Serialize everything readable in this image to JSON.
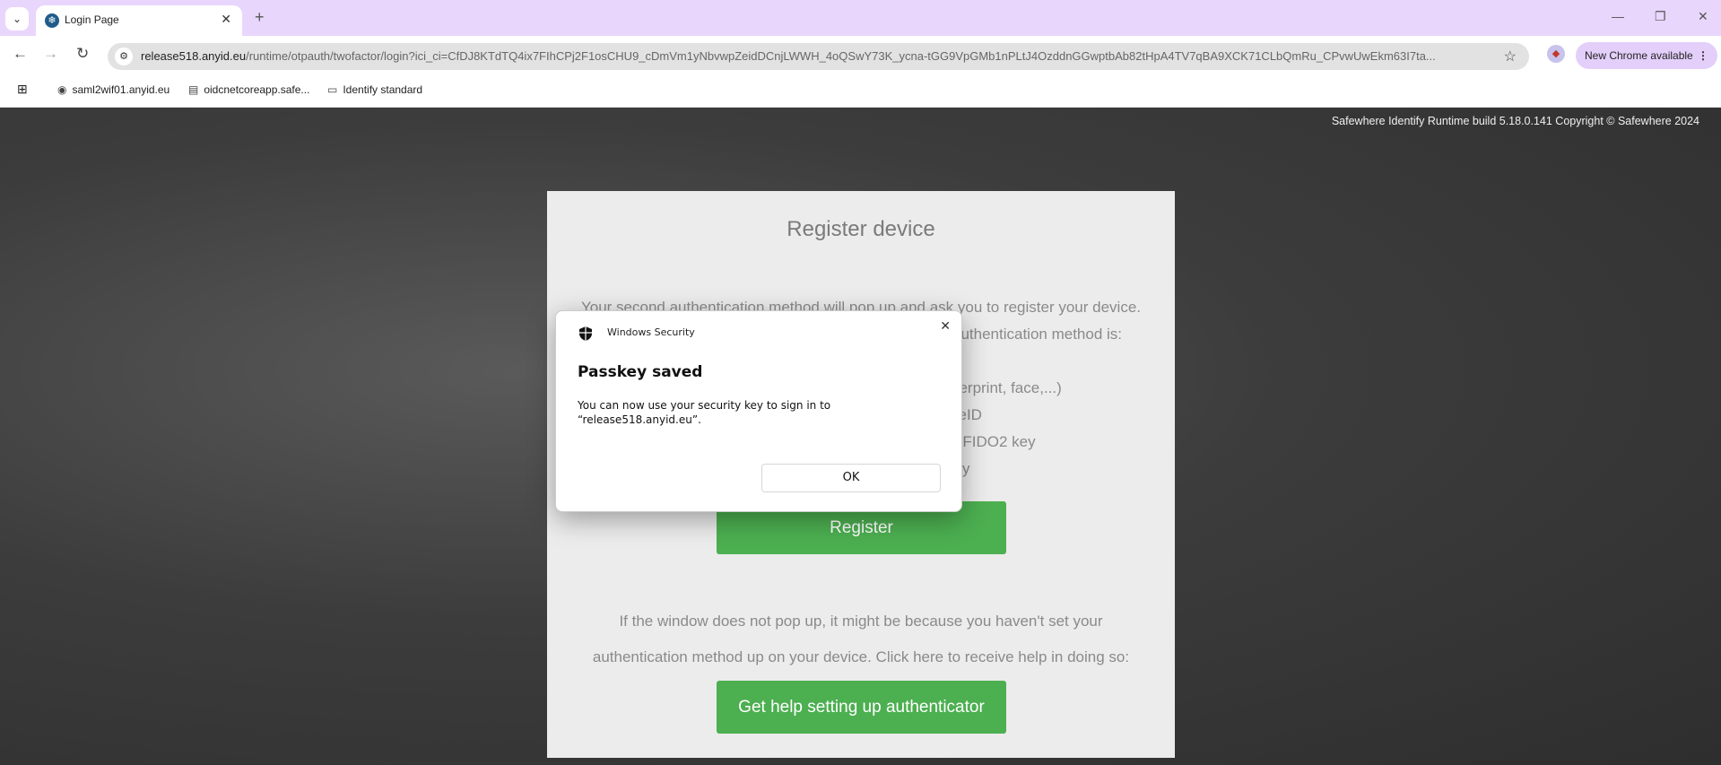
{
  "browser": {
    "tab": {
      "title": "Login Page",
      "close": "✕"
    },
    "new_tab": "+",
    "window_controls": {
      "minimize": "—",
      "restore": "❐",
      "close": "✕"
    },
    "address": {
      "host": "release518.anyid.eu",
      "path": "/runtime/otpauth/twofactor/login?ici_ci=CfDJ8KTdTQ4ix7FIhCPj2F1osCHU9_cDmVm1yNbvwpZeidDCnjLWWH_4oQSwY73K_ycna-tGG9VpGMb1nPLtJ4OzddnGGwptbAb82tHpA4TV7qBA9XCK71CLbQmRu_CPvwUwEkm63I7ta..."
    },
    "update_label": "New Chrome available",
    "bookmarks": [
      {
        "label": "saml2wif01.anyid.eu",
        "icon": "globe-icon"
      },
      {
        "label": "oidcnetcoreapp.safe...",
        "icon": "page-icon"
      },
      {
        "label": "Identify standard",
        "icon": "folder-icon"
      }
    ]
  },
  "page": {
    "copyright": "Safewhere Identify Runtime build 5.18.0.141 Copyright © Safewhere 2024",
    "title": "Register device",
    "intro_line1": "Your second authentication method will pop up and ask you to register your device.",
    "intro_line2_visible": "authentication method is:",
    "list_fragments": [
      "gerprint, face,...)",
      "ceID",
      "r FIDO2 key",
      "y"
    ],
    "register_label": "Register",
    "help_line1": "If the window does not pop up, it might be because you haven't set your",
    "help_line2": "authentication method up on your device. Click here to receive help in doing so:",
    "help_button": "Get help setting up authenticator",
    "accent": "#4caf50"
  },
  "dialog": {
    "app": "Windows Security",
    "title": "Passkey saved",
    "body_line1": "You can now use your security key to sign in to",
    "body_line2": "“release518.anyid.eu”.",
    "ok": "OK",
    "close": "✕"
  }
}
